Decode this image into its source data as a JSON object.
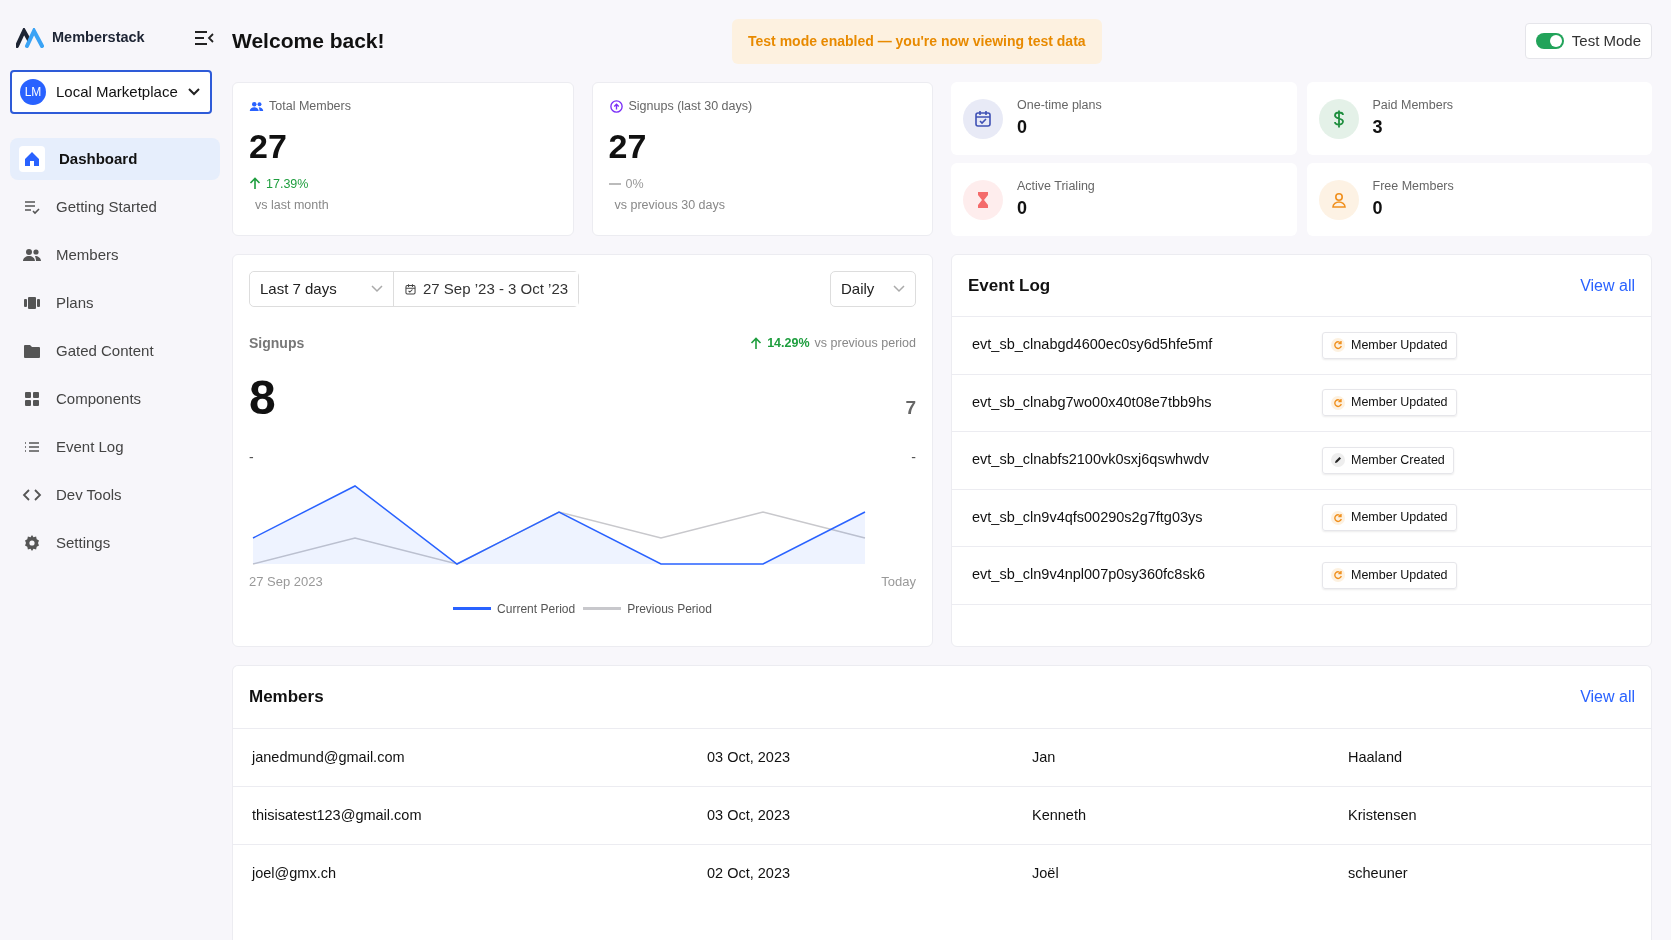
{
  "sidebar": {
    "logo": "Memberstack",
    "workspace": {
      "initials": "LM",
      "name": "Local Marketplace"
    },
    "items": [
      {
        "label": "Dashboard",
        "selected": true
      },
      {
        "label": "Getting Started",
        "selected": false
      },
      {
        "label": "Members",
        "selected": false
      },
      {
        "label": "Plans",
        "selected": false
      },
      {
        "label": "Gated Content",
        "selected": false
      },
      {
        "label": "Components",
        "selected": false
      },
      {
        "label": "Event Log",
        "selected": false
      },
      {
        "label": "Dev Tools",
        "selected": false
      },
      {
        "label": "Settings",
        "selected": false
      }
    ]
  },
  "header": {
    "title": "Welcome back!",
    "banner": "Test mode enabled — you're now viewing test data",
    "toggle": {
      "label": "Test Mode",
      "on": true
    }
  },
  "stat_cards": [
    {
      "label": "Total Members",
      "value": "27",
      "kind": "up",
      "change": "17.39%",
      "note": "vs last month"
    },
    {
      "label": "Signups (last 30 days)",
      "value": "27",
      "kind": "flat",
      "change": "0%",
      "note": "vs previous 30 days"
    }
  ],
  "mini_stats": [
    {
      "label": "One-time plans",
      "value": "0"
    },
    {
      "label": "Paid Members",
      "value": "3"
    },
    {
      "label": "Active Trialing",
      "value": "0"
    },
    {
      "label": "Free Members",
      "value": "0"
    }
  ],
  "signups_panel": {
    "range": "Last 7 days",
    "dates": "27 Sep ’23 - 3 Oct ’23",
    "interval": "Daily",
    "title": "Signups",
    "change": "14.29%",
    "change_note": "vs previous period",
    "current_total": "8",
    "current_mark": "-",
    "previous_total": "7",
    "previous_mark": "-",
    "start_label": "27 Sep 2023",
    "end_label": "Today",
    "legend": [
      {
        "name": "Current Period",
        "color": "#2962ff"
      },
      {
        "name": "Previous Period",
        "color": "#c8c8cc"
      }
    ]
  },
  "event_log": {
    "title": "Event Log",
    "link": "View all",
    "events": [
      {
        "id": "evt_sb_clnabgd4600ec0sy6d5hfe5mf",
        "kind": "updated",
        "label": "Member Updated"
      },
      {
        "id": "evt_sb_clnabg7wo00x40t08e7tbb9hs",
        "kind": "updated",
        "label": "Member Updated"
      },
      {
        "id": "evt_sb_clnabfs2100vk0sxj6qswhwdv",
        "kind": "created",
        "label": "Member Created"
      },
      {
        "id": "evt_sb_cln9v4qfs00290s2g7ftg03ys",
        "kind": "updated",
        "label": "Member Updated"
      },
      {
        "id": "evt_sb_cln9v4npl007p0sy360fc8sk6",
        "kind": "updated",
        "label": "Member Updated"
      }
    ]
  },
  "members": {
    "title": "Members",
    "link": "View all",
    "rows": [
      {
        "email": "janedmund@gmail.com",
        "date": "03 Oct, 2023",
        "first_name": "Jan",
        "last_name": "Haaland"
      },
      {
        "email": "thisisatest123@gmail.com",
        "date": "03 Oct, 2023",
        "first_name": "Kenneth",
        "last_name": "Kristensen"
      },
      {
        "email": "joel@gmx.ch",
        "date": "02 Oct, 2023",
        "first_name": "Joël",
        "last_name": "scheuner"
      }
    ]
  }
}
